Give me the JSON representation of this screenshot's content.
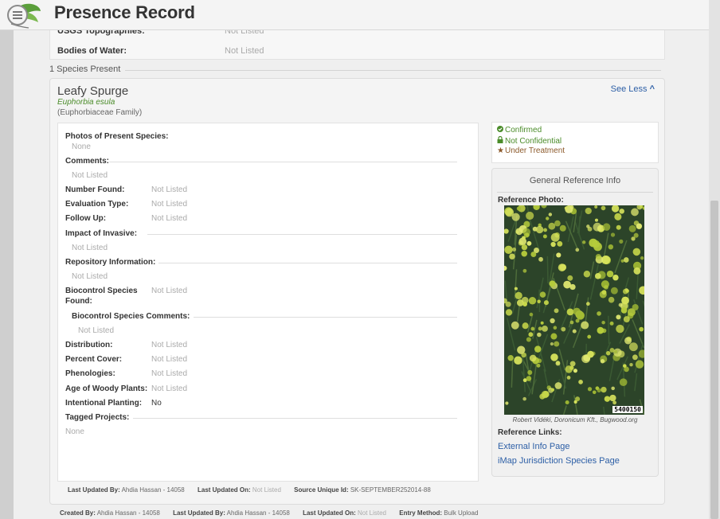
{
  "header": {
    "title": "Presence Record",
    "logo_icon": "leaf-logo-icon"
  },
  "top_fields": [
    {
      "label": "USGS Topographies:",
      "value": "Not Listed"
    },
    {
      "label": "Bodies of Water:",
      "value": "Not Listed"
    }
  ],
  "species_present_label": "1 Species Present",
  "species": {
    "common_name": "Leafy Spurge",
    "scientific_name": "Euphorbia esula",
    "family": "(Euphorbiaceae Family)",
    "toggle_label": "See Less",
    "toggle_icon": "chevron-up-icon"
  },
  "details": {
    "photos_label": "Photos of Present Species:",
    "photos_value": "None",
    "comments_label": "Comments:",
    "comments_value": "Not Listed",
    "number_found_label": "Number Found:",
    "number_found_value": "Not Listed",
    "evaluation_type_label": "Evaluation Type:",
    "evaluation_type_value": "Not Listed",
    "follow_up_label": "Follow Up:",
    "follow_up_value": "Not Listed",
    "impact_label": "Impact of Invasive:",
    "impact_value": "Not Listed",
    "repository_label": "Repository Information:",
    "repository_value": "Not Listed",
    "biocontrol_found_label_1": "Biocontrol Species",
    "biocontrol_found_label_2": "Found:",
    "biocontrol_found_value": "Not Listed",
    "biocontrol_comments_label": "Biocontrol Species Comments:",
    "biocontrol_comments_value": "Not Listed",
    "distribution_label": "Distribution:",
    "distribution_value": "Not Listed",
    "percent_cover_label": "Percent Cover:",
    "percent_cover_value": "Not Listed",
    "phenologies_label": "Phenologies:",
    "phenologies_value": "Not Listed",
    "age_woody_label": "Age of Woody Plants:",
    "age_woody_value": "Not Listed",
    "intentional_label": "Intentional Planting:",
    "intentional_value": "No",
    "tagged_label": "Tagged Projects:",
    "tagged_value": "None"
  },
  "status": {
    "confirmed": "Confirmed",
    "confidential": "Not Confidential",
    "treatment": "Under Treatment",
    "colors": {
      "green": "#4b8c2a",
      "brown": "#8c5a2b"
    }
  },
  "reference": {
    "title": "General Reference Info",
    "photo_label": "Reference Photo:",
    "photo_id": "5400150",
    "caption": "Robert Vidéki, Doronicum Kft., Bugwood.org",
    "links_label": "Reference Links:",
    "links": [
      "External Info Page",
      "iMap Jurisdiction Species Page"
    ]
  },
  "footer_species": {
    "updated_by_label": "Last Updated By:",
    "updated_by_value": "Ahdia Hassan - 14058",
    "updated_on_label": "Last Updated On:",
    "updated_on_value": "Not Listed",
    "source_label": "Source Unique Id:",
    "source_value": "SK-SEPTEMBER252014-88"
  },
  "footer_record": {
    "created_by_label": "Created By:",
    "created_by_value": "Ahdia Hassan - 14058",
    "updated_by_label": "Last Updated By:",
    "updated_by_value": "Ahdia Hassan - 14058",
    "updated_on_label": "Last Updated On:",
    "updated_on_value": "Not Listed",
    "entry_method_label": "Entry Method:",
    "entry_method_value": "Bulk Upload"
  },
  "accent_color": "#2d5fa6"
}
